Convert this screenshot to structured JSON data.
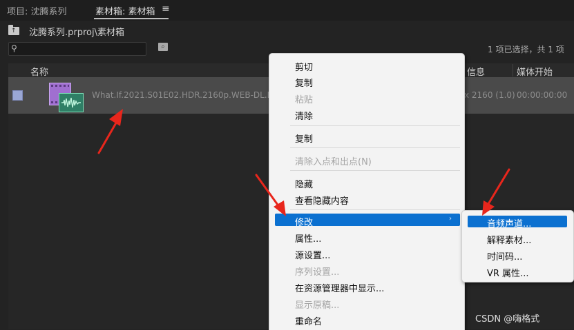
{
  "tabs": {
    "project_label": "项目: 沈腾系列",
    "bin_label": "素材箱: 素材箱",
    "menu_icon": "≡"
  },
  "path": {
    "text": "沈腾系列.prproj\\素材箱",
    "folder_icon": "folder-up-icon"
  },
  "search": {
    "icon": "search-icon",
    "placeholder": "",
    "status_text": "1 项已选择，共 1 项"
  },
  "columns": {
    "name": "名称",
    "info": "信息",
    "media_start": "媒体开始"
  },
  "clip": {
    "filename": "What.If.2021.S01E02.HDR.2160p.WEB-DL.DDP5.1.H.",
    "dimensions": "x 2160 (1.0)",
    "media_start": "00:00:00:00"
  },
  "context_menu": {
    "items": [
      {
        "label": "剪切",
        "disabled": false
      },
      {
        "label": "复制",
        "disabled": false
      },
      {
        "label": "粘贴",
        "disabled": true
      },
      {
        "label": "清除",
        "disabled": false
      },
      {
        "label": "复制",
        "disabled": false
      },
      {
        "label": "清除入点和出点(N)",
        "disabled": true
      },
      {
        "label": "隐藏",
        "disabled": false
      },
      {
        "label": "查看隐藏内容",
        "disabled": false
      },
      {
        "label": "修改",
        "disabled": false,
        "highlighted": true,
        "submenu_arrow": "›"
      },
      {
        "label": "属性...",
        "disabled": false
      },
      {
        "label": "源设置...",
        "disabled": false
      },
      {
        "label": "序列设置...",
        "disabled": true
      },
      {
        "label": "在资源管理器中显示...",
        "disabled": false
      },
      {
        "label": "显示原稿...",
        "disabled": true
      },
      {
        "label": "重命名",
        "disabled": false
      }
    ]
  },
  "submenu": {
    "items": [
      {
        "label": "音频声道...",
        "highlighted": true
      },
      {
        "label": "解释素材..."
      },
      {
        "label": "时间码..."
      },
      {
        "label": "VR 属性..."
      }
    ]
  },
  "watermark": "CSDN @嗨格式",
  "colors": {
    "highlight": "#0b70d0",
    "annotation_arrow": "#e8261c",
    "panel_bg": "#232323",
    "selected_row": "#4a4a4a"
  }
}
